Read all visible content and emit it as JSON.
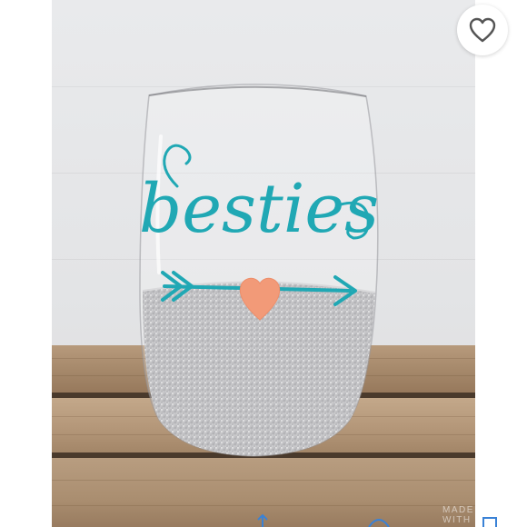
{
  "listing": {
    "image_alt": "Stemless wine glass with teal script lettering, arrow with coral heart, and silver glitter dipped base",
    "glass_text": "besties",
    "watermark": "MADE WITH"
  },
  "actions": {
    "like_icon": "heart-outline-icon"
  },
  "colors": {
    "lettering": "#20a8b4",
    "heart": "#f29a78",
    "glitter": "#c6c6c8"
  }
}
